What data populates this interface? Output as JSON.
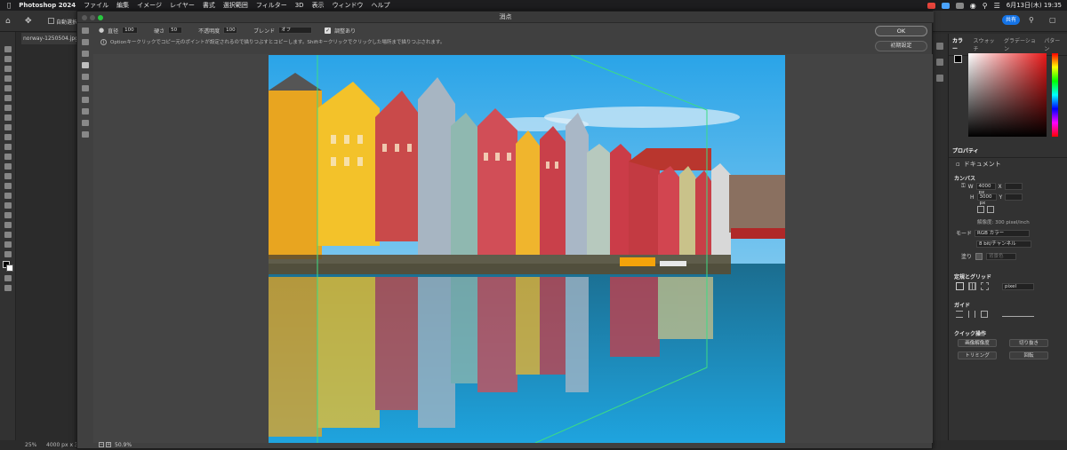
{
  "menubar": {
    "app": "Photoshop 2024",
    "items": [
      "ファイル",
      "編集",
      "イメージ",
      "レイヤー",
      "書式",
      "選択範囲",
      "フィルター",
      "3D",
      "表示",
      "ウィンドウ",
      "ヘルプ"
    ],
    "clock": "6月13日(木)  19:35"
  },
  "ps": {
    "auto_select": "自動選択",
    "doc_tab": "norway-1250504.jpg",
    "zoom": "25%",
    "doc_size": "4000 px x 30"
  },
  "dialog": {
    "title": "消点",
    "options": {
      "diameter_label": "直径",
      "diameter_value": "100",
      "hardness_label": "硬さ",
      "hardness_value": "50",
      "opacity_label": "不透明度",
      "opacity_value": "100",
      "blend_label": "ブレンド",
      "blend_value": "オフ",
      "aligned_label": "調整あり"
    },
    "info": "Optionキークリックでコピー元のポイントが設定されるので描りつぶすとコピーします。Shiftキークリックでクリックした場所まで描りつぶされます。",
    "ok_label": "OK",
    "reset_label": "初期設定",
    "zoom_value": "50.9%"
  },
  "panels": {
    "color_tabs": [
      "カラー",
      "スウォッチ",
      "グラデーション",
      "パターン"
    ],
    "share_label": "共有",
    "properties_tab": "プロパティ",
    "document_label": "ドキュメント",
    "canvas_section": "カンバス",
    "width_label": "W",
    "width_value": "4000 px",
    "height_label": "H",
    "height_value": "3000 px",
    "x_label": "X",
    "y_label": "Y",
    "resolution": "解像度: 300 pixel/inch",
    "mode_label": "モード",
    "mode_value": "RGB カラー",
    "depth_value": "8 bit/チャンネル",
    "fill_label": "塗り",
    "fill_value": "背景色",
    "rulers_section": "定規とグリッド",
    "unit_value": "pixel",
    "guides_section": "ガイド",
    "quick_section": "クイック操作",
    "btn_resize": "画像解像度",
    "btn_crop": "切り抜き",
    "btn_trim": "トリミング",
    "btn_rotate": "回転"
  },
  "colors": {
    "accent": "#1473e6",
    "plane_grid": "#3ddc84"
  }
}
